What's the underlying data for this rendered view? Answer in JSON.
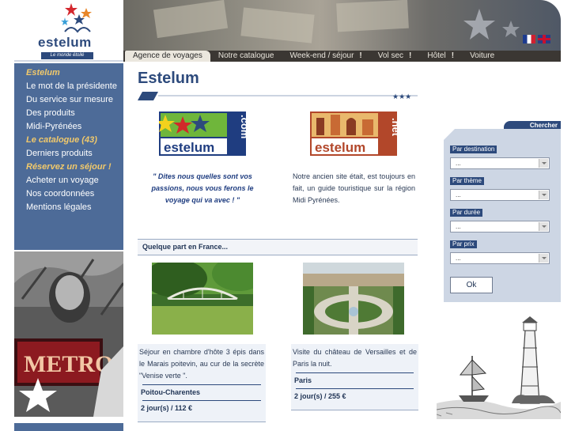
{
  "logo": {
    "word": "estelum",
    "tagline": "Le monde étoilé"
  },
  "flags": [
    "flag-fr-icon",
    "flag-uk-icon"
  ],
  "menu": [
    {
      "label": "Agence de voyages",
      "active": true
    },
    {
      "label": "Notre catalogue"
    },
    {
      "label": "Week-end / séjour",
      "bang": "!"
    },
    {
      "label": "Vol sec",
      "bang": "!"
    },
    {
      "label": "Hôtel",
      "bang": "!"
    },
    {
      "label": "Voiture"
    }
  ],
  "sidebar": {
    "items": [
      {
        "label": "Estelum",
        "heading": true
      },
      {
        "label": "Le mot de la présidente"
      },
      {
        "label": "Du service sur mesure"
      },
      {
        "label": "Des produits"
      },
      {
        "label": "Midi-Pyrénées"
      },
      {
        "label": "Le catalogue (43)",
        "heading": true
      },
      {
        "label": "Derniers produits"
      },
      {
        "label": "Réservez un séjour !",
        "heading": true
      },
      {
        "label": "Acheter un voyage"
      },
      {
        "label": "Nos coordonnées"
      },
      {
        "label": "Mentions légales"
      }
    ],
    "photo_sign": "METRO"
  },
  "main": {
    "title": "Estelum",
    "promo_left": {
      "word": "estelum",
      "ext": ".com",
      "text": "\" Dites nous quelles sont vos passions, nous vous ferons le voyage qui va avec ! \""
    },
    "promo_right": {
      "word": "estelum",
      "ext": ".net",
      "text": "Notre ancien site était, est toujours en fait, un guide touristique sur la région Midi Pyrénées."
    },
    "section_title": "Quelque part en France...",
    "offers": [
      {
        "desc": "Séjour en chambre d'hôte 3 épis dans le Marais poitevin, au cur de la secrète \"Venise verte \".",
        "region": "Poitou-Charentes",
        "price": "2 jour(s) / 112 €"
      },
      {
        "desc": "Visite du château de Versailles et de Paris la nuit.",
        "region": "Paris",
        "price": "2 jour(s) / 255 €"
      }
    ]
  },
  "search": {
    "tab_label": "Chercher",
    "fields": [
      {
        "label": "Par destination",
        "value": "..."
      },
      {
        "label": "Par thème",
        "value": "..."
      },
      {
        "label": "Par durée",
        "value": "..."
      },
      {
        "label": "Par prix",
        "value": "..."
      }
    ],
    "ok_label": "Ok"
  },
  "colors": {
    "brand_blue": "#2d4a7c",
    "sidebar_blue": "#4d6b98",
    "heading_gold": "#f1c96b",
    "menubar": "#3b3733"
  }
}
